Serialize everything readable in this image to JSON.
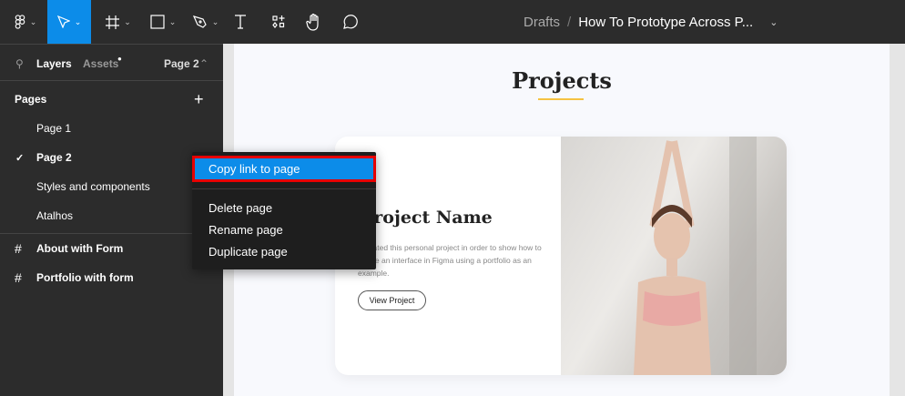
{
  "toolbar": {
    "tools": [
      "figma-menu",
      "move",
      "frame",
      "shape",
      "pen",
      "text",
      "resources",
      "hand",
      "comment"
    ],
    "active": "move",
    "accent": "#0c8ce9"
  },
  "breadcrumb": {
    "folder": "Drafts",
    "separator": "/",
    "file": "How To Prototype Across P..."
  },
  "sidebar": {
    "tab_layers": "Layers",
    "tab_assets": "Assets",
    "current_page": "Page 2",
    "pages_title": "Pages",
    "pages": [
      {
        "label": "Page 1",
        "checked": false
      },
      {
        "label": "Page 2",
        "checked": true
      },
      {
        "label": "Styles and components",
        "checked": false
      },
      {
        "label": "Atalhos",
        "checked": false
      }
    ],
    "layers": [
      {
        "label": "About with Form"
      },
      {
        "label": "Portfolio with form"
      }
    ]
  },
  "context_menu": {
    "highlighted": "Copy link to page",
    "items": [
      "Delete page",
      "Rename page",
      "Duplicate page"
    ],
    "highlight_color": "#0c8ce9",
    "outline_color": "#e60000"
  },
  "design": {
    "heading": "Projects",
    "card_title": "Project Name",
    "card_desc": "I created this personal project in order to show how to create an interface in Figma using a portfolio as an example.",
    "button": "View Project",
    "underline_color": "#f5c242"
  }
}
